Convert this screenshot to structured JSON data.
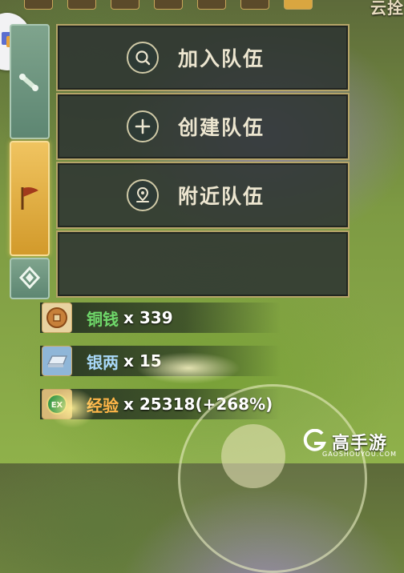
{
  "header": {
    "right_text": "云拴"
  },
  "menu": {
    "join_team": {
      "label": "加入队伍",
      "icon": "search-icon"
    },
    "create_team": {
      "label": "创建队伍",
      "icon": "plus-icon"
    },
    "nearby_team": {
      "label": "附近队伍",
      "icon": "location-pin-icon"
    }
  },
  "side_tabs": [
    {
      "icon": "scroll-icon",
      "active": false
    },
    {
      "icon": "flag-icon",
      "active": true
    },
    {
      "icon": "diamond-icon",
      "active": false
    }
  ],
  "rewards": [
    {
      "name": "铜钱",
      "qty": "x 339",
      "icon": "copper-coin-icon",
      "color": "#6fd86a"
    },
    {
      "name": "银两",
      "qty": "x 15",
      "icon": "silver-ingot-icon",
      "color": "#a8d8f8"
    },
    {
      "name": "经验",
      "qty": "x 25318(+268%)",
      "icon": "exp-badge-icon",
      "color": "#ffb648"
    }
  ],
  "logo": {
    "brand": "高手游",
    "sub": "GAOSHOUYOU.COM"
  }
}
